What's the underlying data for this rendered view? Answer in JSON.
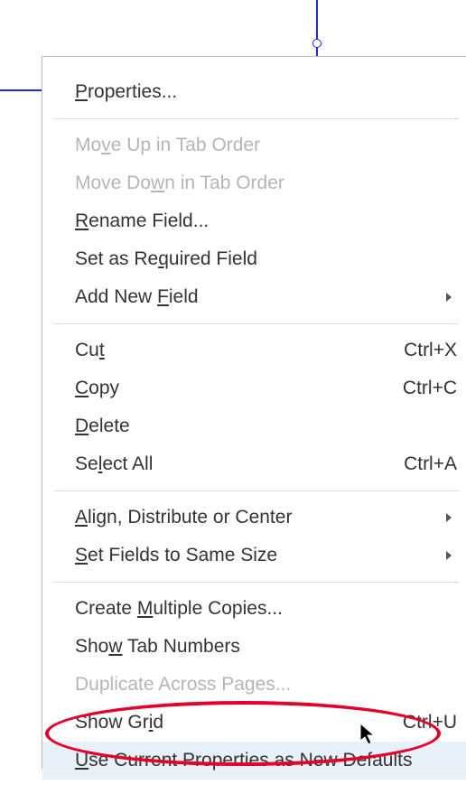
{
  "menu": {
    "properties": {
      "pre": "",
      "u": "P",
      "post": "roperties..."
    },
    "moveUp": {
      "pre": "Mo",
      "u": "v",
      "post": "e Up in Tab Order"
    },
    "moveDown": {
      "pre": "Move Do",
      "u": "w",
      "post": "n in Tab Order"
    },
    "rename": {
      "pre": "",
      "u": "R",
      "post": "ename Field..."
    },
    "setRequired": {
      "pre": "Set as Re",
      "u": "q",
      "post": "uired Field"
    },
    "addNew": {
      "pre": "Add New ",
      "u": "F",
      "post": "ield"
    },
    "cut": {
      "pre": "Cu",
      "u": "t",
      "post": ""
    },
    "copy": {
      "pre": "",
      "u": "C",
      "post": "opy"
    },
    "delete": {
      "pre": "",
      "u": "D",
      "post": "elete"
    },
    "selectAll": {
      "pre": "Se",
      "u": "l",
      "post": "ect All"
    },
    "align": {
      "pre": "",
      "u": "A",
      "post": "lign, Distribute or Center"
    },
    "sameSize": {
      "pre": "",
      "u": "S",
      "post": "et Fields to Same Size"
    },
    "multiple": {
      "pre": "Create ",
      "u": "M",
      "post": "ultiple Copies..."
    },
    "tabNumbers": {
      "pre": "Sho",
      "u": "w",
      "post": " Tab Numbers"
    },
    "duplicate": {
      "pre": "Duplicate Across Pages...",
      "u": "",
      "post": ""
    },
    "showGrid": {
      "pre": "Show Gr",
      "u": "i",
      "post": "d"
    },
    "useDefaults": {
      "pre": "",
      "u": "U",
      "post": "se Current Properties as New Defaults"
    }
  },
  "shortcuts": {
    "cut": "Ctrl+X",
    "copy": "Ctrl+C",
    "selectAll": "Ctrl+A",
    "showGrid": "Ctrl+U"
  }
}
